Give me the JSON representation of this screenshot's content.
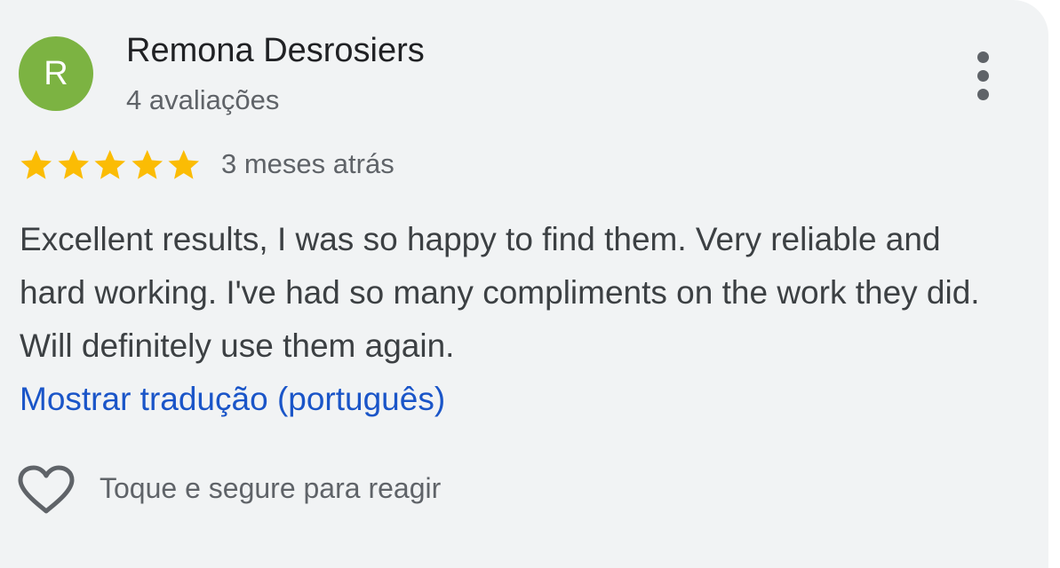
{
  "review": {
    "avatar_initial": "R",
    "author_name": "Remona Desrosiers",
    "review_count": "4 avaliações",
    "rating": 5,
    "rating_max": 5,
    "date": "3 meses atrás",
    "text": "Excellent results, I was so happy to find them. Very reliable and hard working. I've had so many compliments on the work they did. Will definitely use them again.",
    "translate_link": "Mostrar tradução (português)",
    "react_label": "Toque e segure para reagir"
  },
  "icons": {
    "more": "more-vert-icon",
    "star": "star-icon",
    "heart": "heart-outline-icon"
  },
  "colors": {
    "avatar": "#7cb342",
    "star": "#fbbc04",
    "link": "#1a55c8",
    "card_background": "#f1f3f4"
  }
}
